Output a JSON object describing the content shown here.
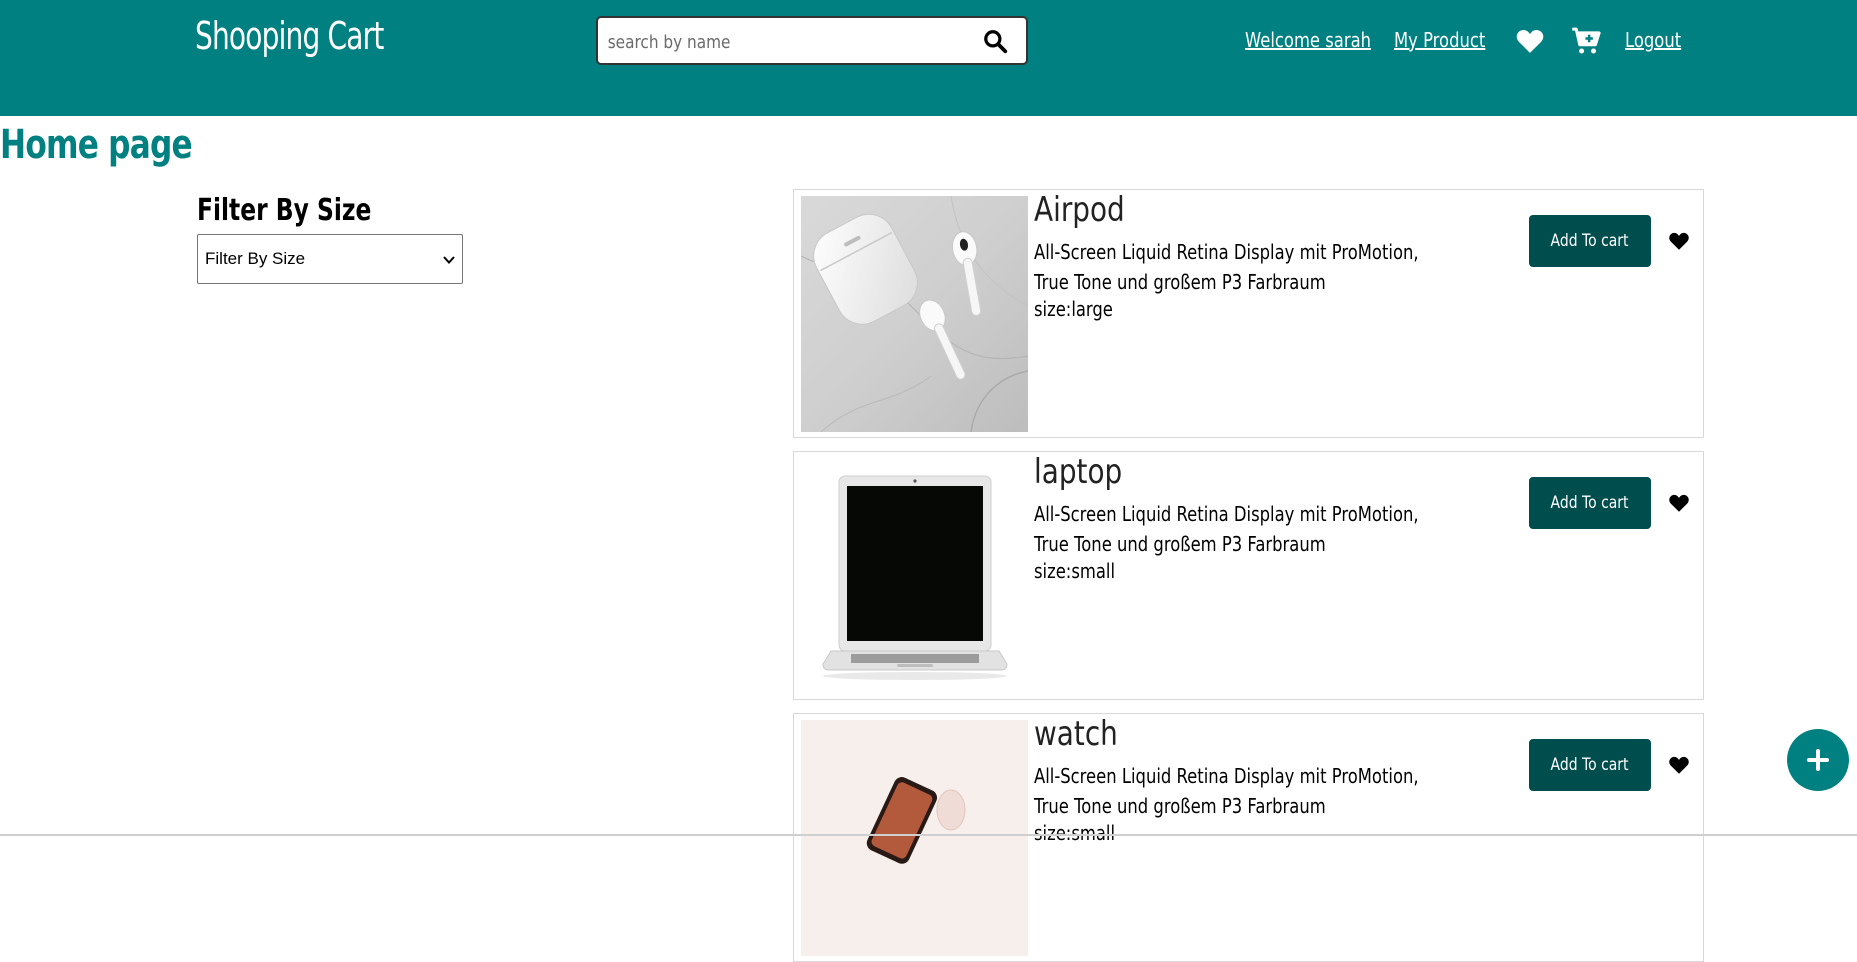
{
  "header": {
    "brand": "Shooping Cart",
    "search": {
      "placeholder": "search by name",
      "value": ""
    },
    "nav": {
      "welcome": "Welcome sarah",
      "my_product": "My Product",
      "logout": "Logout"
    },
    "icons": [
      "search-icon",
      "heart-icon",
      "cart-plus-icon"
    ]
  },
  "page_title": "Home page",
  "filter": {
    "label": "Filter By Size",
    "selected": "Filter By Size"
  },
  "products": [
    {
      "name": "Airpod",
      "desc_line1": "All-Screen Liquid Retina Display mit ProMotion,",
      "desc_line2": "True Tone und großem P3 Farbraum",
      "size": "size:large",
      "button": "Add To cart"
    },
    {
      "name": "laptop",
      "desc_line1": "All-Screen Liquid Retina Display mit ProMotion,",
      "desc_line2": "True Tone und großem P3 Farbraum",
      "size": "size:small",
      "button": "Add To cart"
    },
    {
      "name": "watch",
      "desc_line1": "All-Screen Liquid Retina Display mit ProMotion,",
      "desc_line2": "True Tone und großem P3 Farbraum",
      "size": "size:small",
      "button": "Add To cart"
    }
  ],
  "colors": {
    "primary": "#008080",
    "button": "#004d4d"
  }
}
